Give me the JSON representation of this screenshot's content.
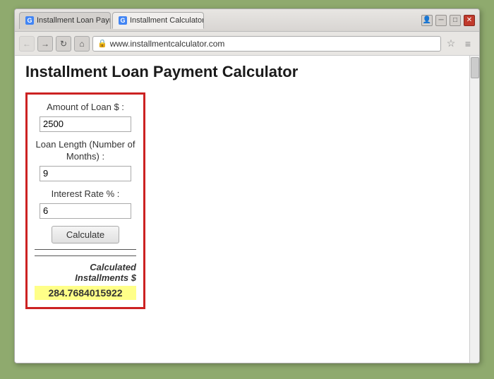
{
  "browser": {
    "tabs": [
      {
        "id": "tab1",
        "label": "Installment Loan Payment...",
        "active": false,
        "favicon": "G"
      },
      {
        "id": "tab2",
        "label": "Installment Calculator - C...",
        "active": true,
        "favicon": "G"
      }
    ],
    "window_controls": {
      "user_icon": "👤",
      "minimize": "─",
      "maximize": "□",
      "close": "✕"
    },
    "nav": {
      "back": "←",
      "forward": "→",
      "refresh": "↻",
      "home": "⌂",
      "url": "www.installmentcalculator.com",
      "star": "☆",
      "menu": "≡"
    }
  },
  "page": {
    "title": "Installment Loan Payment Calculator",
    "calculator": {
      "loan_amount_label": "Amount of Loan $ :",
      "loan_amount_value": "2500",
      "loan_amount_placeholder": "2500",
      "loan_length_label": "Loan Length (Number of Months) :",
      "loan_length_value": "9",
      "loan_length_placeholder": "9",
      "interest_rate_label": "Interest Rate % :",
      "interest_rate_value": "6",
      "interest_rate_placeholder": "6",
      "calculate_button": "Calculate",
      "result_label": "Calculated Installments $",
      "result_value": "284.7684015922"
    }
  }
}
